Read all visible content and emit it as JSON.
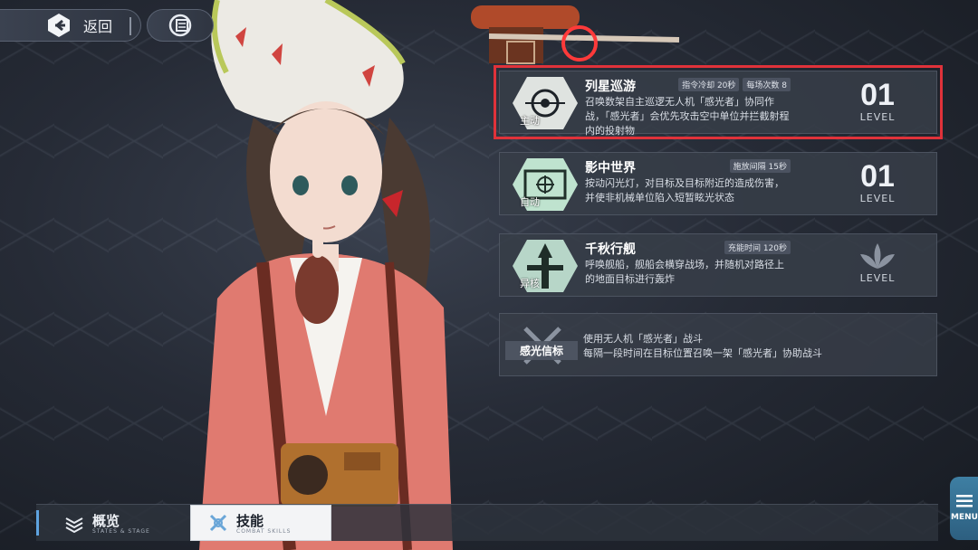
{
  "nav": {
    "back_label": "返回",
    "back_icon": "back-arrow-icon",
    "home_icon": "base-logo-icon"
  },
  "skills": [
    {
      "name": "列星巡游",
      "type": "主动",
      "badges": [
        "指令冷却 20秒",
        "每场次数 8"
      ],
      "description": "召唤数架自主巡逻无人机「感光者」协同作战，「感光者」会优先攻击空中单位并拦截射程内的投射物",
      "level": "01",
      "level_label": "LEVEL",
      "selected": true
    },
    {
      "name": "影中世界",
      "type": "自动",
      "badges": [
        "施放间隔 15秒"
      ],
      "description": "按动闪光灯，对目标及目标附近的造成伤害，并使非机械单位陷入短暂眩光状态",
      "level": "01",
      "level_label": "LEVEL",
      "selected": false
    },
    {
      "name": "千秋行舰",
      "type": "异核",
      "badges": [
        "充能时间 120秒"
      ],
      "description": "呼唤舰船，舰船会横穿战场，并随机对路径上的地面目标进行轰炸",
      "level": "",
      "level_label": "LEVEL",
      "selected": false
    }
  ],
  "passive": {
    "name": "感光信标",
    "line1": "使用无人机「感光者」战斗",
    "line2": "每隔一段时间在目标位置召唤一架「感光者」协助战斗"
  },
  "bottom_tabs": [
    {
      "label": "概览",
      "sub": "STATES & STAGE",
      "icon": "overview-icon",
      "active": false
    },
    {
      "label": "技能",
      "sub": "COMBAT SKILLS",
      "icon": "skills-icon",
      "active": true
    }
  ],
  "menu": {
    "label": "MENU",
    "icon": "menu-icon"
  },
  "colors": {
    "selection": "#e0323a",
    "accent": "#5ea3e0",
    "menu": "#3e7fa3"
  }
}
